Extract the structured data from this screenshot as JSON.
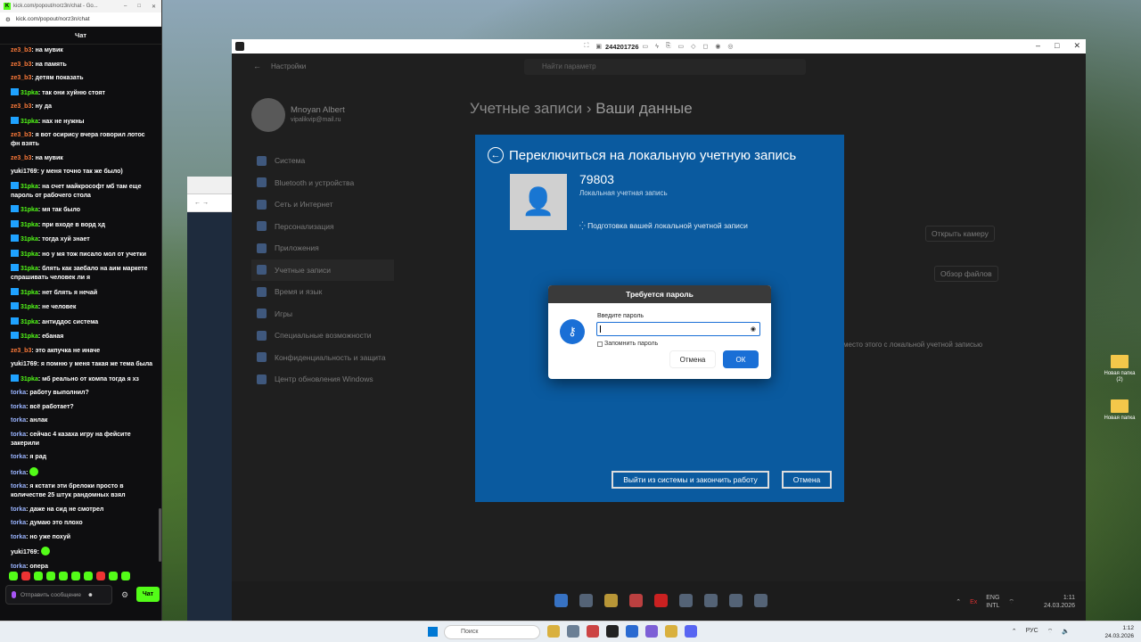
{
  "chat": {
    "tab_title": "kick.com/popout/norz3n/chat - Go...",
    "url": "kick.com/popout/norz3n/chat",
    "header": "Чат",
    "messages": [
      {
        "user": "ze3_b3",
        "color": "orange",
        "badge": false,
        "text": ": на мувик"
      },
      {
        "user": "ze3_b3",
        "color": "orange",
        "badge": false,
        "text": ": на память"
      },
      {
        "user": "ze3_b3",
        "color": "orange",
        "badge": false,
        "text": ": детям показать"
      },
      {
        "user": "31pka",
        "color": "green",
        "badge": true,
        "text": ": так они хуйню стоят"
      },
      {
        "user": "ze3_b3",
        "color": "orange",
        "badge": false,
        "text": ": ну да"
      },
      {
        "user": "31pka",
        "color": "green",
        "badge": true,
        "text": ": нах не нужны"
      },
      {
        "user": "ze3_b3",
        "color": "orange",
        "badge": false,
        "text": ": я вот осирису вчера говорил лотос фн взять"
      },
      {
        "user": "ze3_b3",
        "color": "orange",
        "badge": false,
        "text": ": на мувик"
      },
      {
        "user": "yuki1769",
        "color": "white",
        "badge": false,
        "text": ": у меня точно так же было)"
      },
      {
        "user": "31pka",
        "color": "green",
        "badge": true,
        "text": ": на счет майкрософт мб там еще пароль от рабочего стола"
      },
      {
        "user": "31pka",
        "color": "green",
        "badge": true,
        "text": ": мя так было"
      },
      {
        "user": "31pka",
        "color": "green",
        "badge": true,
        "text": ": при входе в ворд хд"
      },
      {
        "user": "31pka",
        "color": "green",
        "badge": true,
        "text": ": тогда хуй знает"
      },
      {
        "user": "31pka",
        "color": "green",
        "badge": true,
        "text": ": но у мя тож писало мол от учетки"
      },
      {
        "user": "31pka",
        "color": "green",
        "badge": true,
        "text": ": блять как заебало на аим маркете спрашивать человек ли я"
      },
      {
        "user": "31pka",
        "color": "green",
        "badge": true,
        "text": ": нет блять я нечай"
      },
      {
        "user": "31pka",
        "color": "green",
        "badge": true,
        "text": ": не человек"
      },
      {
        "user": "31pka",
        "color": "green",
        "badge": true,
        "text": ": антиддос система"
      },
      {
        "user": "31pka",
        "color": "green",
        "badge": true,
        "text": ": ебаная"
      },
      {
        "user": "ze3_b3",
        "color": "orange",
        "badge": false,
        "text": ": это акпучка не иначе"
      },
      {
        "user": "yuki1769",
        "color": "white",
        "badge": false,
        "text": ": я помню у меня такая же тема была"
      },
      {
        "user": "31pka",
        "color": "green",
        "badge": true,
        "text": ": мб реально от компа тогда я хз"
      },
      {
        "user": "torka",
        "color": "blue",
        "badge": false,
        "text": ": работу выполнил?"
      },
      {
        "user": "torka",
        "color": "blue",
        "badge": false,
        "text": ": всё работает?"
      },
      {
        "user": "torka",
        "color": "blue",
        "badge": false,
        "text": ": анлак"
      },
      {
        "user": "torka",
        "color": "blue",
        "badge": false,
        "text": ": сейчас 4 казаха игру на фейсите закерили"
      },
      {
        "user": "torka",
        "color": "blue",
        "badge": false,
        "text": ": я рад"
      },
      {
        "user": "torka",
        "color": "blue",
        "badge": false,
        "text": ":",
        "emote": true
      },
      {
        "user": "torka",
        "color": "blue",
        "badge": false,
        "text": ": я кстати эти брелоки просто в количестве 25 штук рандомных взял"
      },
      {
        "user": "torka",
        "color": "blue",
        "badge": false,
        "text": ": даже на сид не смотрел"
      },
      {
        "user": "torka",
        "color": "blue",
        "badge": false,
        "text": ": думаю это плохо"
      },
      {
        "user": "torka",
        "color": "blue",
        "badge": false,
        "text": ": но уже похуй"
      },
      {
        "user": "yuki1769",
        "color": "white",
        "badge": false,
        "text": ":",
        "emote": true
      },
      {
        "user": "torka",
        "color": "blue",
        "badge": false,
        "text": ": опера"
      }
    ],
    "input_placeholder": "Отправить сообщение",
    "send_label": "Чат"
  },
  "remote": {
    "session_id": "244201726"
  },
  "settings": {
    "app_name": "Настройки",
    "search_placeholder": "Найти параметр",
    "user_name": "Mnoyan Albert",
    "user_email": "vipalikvip@mail.ru",
    "nav": [
      "Система",
      "Bluetooth и устройства",
      "Сеть и Интернет",
      "Персонализация",
      "Приложения",
      "Учетные записи",
      "Время и язык",
      "Игры",
      "Специальные возможности",
      "Конфиденциальность и защита",
      "Центр обновления Windows"
    ],
    "active_nav": 5,
    "breadcrumb_parent": "Учетные записи",
    "breadcrumb_sep": "›",
    "breadcrumb_current": "Ваши данные",
    "open_camera": "Открыть камеру",
    "browse_files": "Обзор файлов",
    "local_note": "место этого с локальной учетной записью"
  },
  "local_dialog": {
    "title": "Переключиться на локальную учетную запись",
    "account_name": "79803",
    "account_type": "Локальная учетная запись",
    "preparing": "Подготовка вашей локальной учетной записи",
    "signout_button": "Выйти из системы и закончить работу",
    "cancel_button": "Отмена"
  },
  "password_dialog": {
    "title": "Требуется пароль",
    "field_label": "Введите пароль",
    "remember_label": "Запомнить пароль",
    "cancel_button": "Отмена",
    "ok_button": "ОК"
  },
  "inner_taskbar": {
    "lang": "ENG",
    "lang2": "INTL",
    "time": "1:11",
    "date": "24.03.2026"
  },
  "desktop": {
    "folder1": "Новая папка (2)",
    "folder2": "Новая папка"
  },
  "taskbar": {
    "search_placeholder": "Поиск",
    "lang": "РУС",
    "time": "1:12",
    "date": "24.03.2026"
  }
}
